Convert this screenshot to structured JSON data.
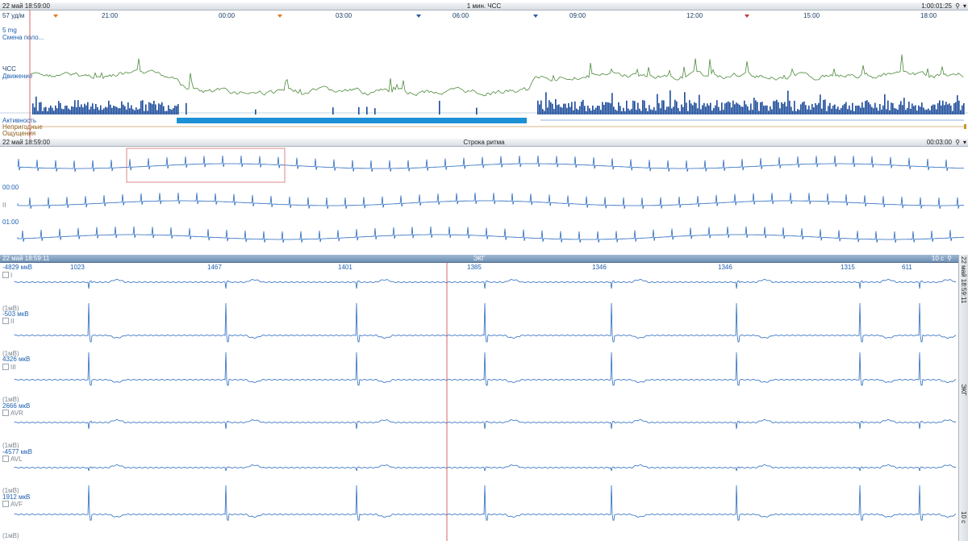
{
  "hr_panel": {
    "datetime": "22 май 18:59:00",
    "title": "1 мин. ЧСС",
    "duration": "1:00:01:25",
    "time_ticks": [
      "21:00",
      "00:00",
      "03:00",
      "06:00",
      "09:00",
      "12:00",
      "15:00",
      "18:00"
    ],
    "hr_value": "57 уд/м",
    "dose": "5 mg",
    "position_change": "Смена поло...",
    "hr_label": "ЧСС",
    "movement_label": "Движение",
    "activity_label": "Активность",
    "unusable_label": "Непригодные",
    "sensations_label": "Ощущения"
  },
  "rhythm_panel": {
    "datetime": "22 май 18:59:00",
    "title": "Строка ритма",
    "duration": "00:03:00",
    "lead": "II",
    "row_times": [
      "00:00",
      "01:00"
    ]
  },
  "ecg_panel": {
    "datetime": "22 май 18:59:11",
    "title": "ЭКГ",
    "duration": "10 с",
    "side_text_top": "22 май 18:59:11",
    "side_text_mid": "ЭКГ",
    "side_text_bottom": "10 с",
    "rr_intervals": [
      "1023",
      "1467",
      "1401",
      "1385",
      "1346",
      "1346",
      "1315",
      "611"
    ],
    "scale_label": "(1мВ)",
    "leads": [
      {
        "name": "I",
        "offset": "-4829 мкВ"
      },
      {
        "name": "II",
        "offset": "-503 мкВ"
      },
      {
        "name": "III",
        "offset": "4326 мкВ"
      },
      {
        "name": "AVR",
        "offset": "2666 мкВ"
      },
      {
        "name": "AVL",
        "offset": "-4577 мкВ"
      },
      {
        "name": "AVF",
        "offset": "1912 мкВ"
      }
    ]
  },
  "colors": {
    "trace": "#2a6bbf",
    "hr_line": "#4d8a3c",
    "cursor": "#d04040",
    "activity": "#1a4a9a",
    "highlight": "#1e90d6"
  }
}
